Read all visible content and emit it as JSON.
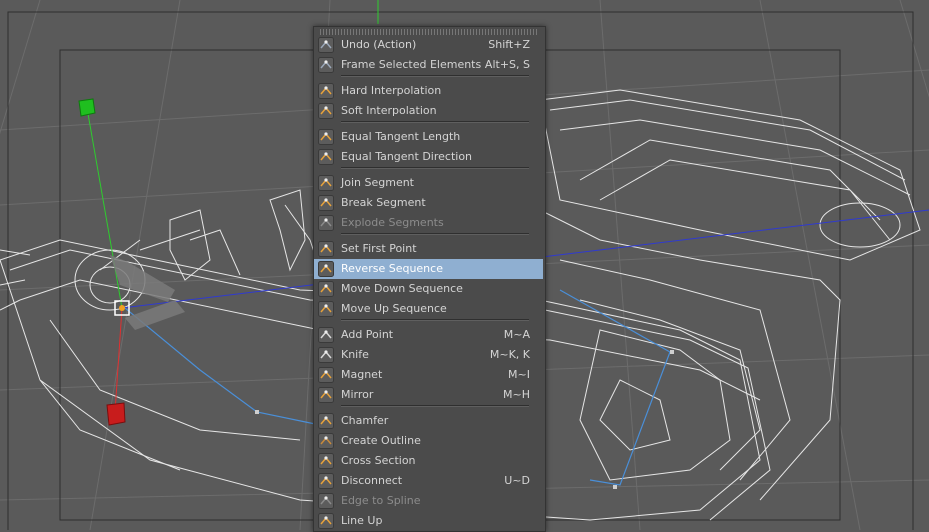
{
  "menu": {
    "items": [
      {
        "label": "Undo (Action)",
        "shortcut": "Shift+Z",
        "icon": "undo-icon"
      },
      {
        "label": "Frame Selected Elements",
        "shortcut": "Alt+S, S",
        "icon": "frame-selected-icon"
      },
      {
        "label": "Hard Interpolation",
        "shortcut": "",
        "icon": "hard-interpolation-icon"
      },
      {
        "label": "Soft Interpolation",
        "shortcut": "",
        "icon": "soft-interpolation-icon"
      },
      {
        "label": "Equal Tangent Length",
        "shortcut": "",
        "icon": "equal-tangent-length-icon"
      },
      {
        "label": "Equal Tangent Direction",
        "shortcut": "",
        "icon": "equal-tangent-direction-icon"
      },
      {
        "label": "Join Segment",
        "shortcut": "",
        "icon": "join-segment-icon"
      },
      {
        "label": "Break Segment",
        "shortcut": "",
        "icon": "break-segment-icon"
      },
      {
        "label": "Explode Segments",
        "shortcut": "",
        "icon": "explode-segments-icon",
        "disabled": true
      },
      {
        "label": "Set First Point",
        "shortcut": "",
        "icon": "set-first-point-icon"
      },
      {
        "label": "Reverse Sequence",
        "shortcut": "",
        "icon": "reverse-sequence-icon",
        "highlighted": true
      },
      {
        "label": "Move Down Sequence",
        "shortcut": "",
        "icon": "move-down-sequence-icon"
      },
      {
        "label": "Move Up Sequence",
        "shortcut": "",
        "icon": "move-up-sequence-icon"
      },
      {
        "label": "Add Point",
        "shortcut": "M~A",
        "icon": "add-point-icon"
      },
      {
        "label": "Knife",
        "shortcut": "M~K, K",
        "icon": "knife-icon"
      },
      {
        "label": "Magnet",
        "shortcut": "M~I",
        "icon": "magnet-icon"
      },
      {
        "label": "Mirror",
        "shortcut": "M~H",
        "icon": "mirror-icon"
      },
      {
        "label": "Chamfer",
        "shortcut": "",
        "icon": "chamfer-icon"
      },
      {
        "label": "Create Outline",
        "shortcut": "",
        "icon": "create-outline-icon"
      },
      {
        "label": "Cross Section",
        "shortcut": "",
        "icon": "cross-section-icon"
      },
      {
        "label": "Disconnect",
        "shortcut": "U~D",
        "icon": "disconnect-icon"
      },
      {
        "label": "Edge to Spline",
        "shortcut": "",
        "icon": "edge-to-spline-icon",
        "disabled": true
      },
      {
        "label": "Line Up",
        "shortcut": "",
        "icon": "line-up-icon"
      }
    ]
  },
  "colors": {
    "viewport_bg": "#5a5a5a",
    "grid": "#6a6a6a",
    "wire": "#e8e8e8",
    "spline": "#4a90d9",
    "axis_x": "#d02020",
    "axis_y": "#22c822",
    "axis_z": "#2a3ad0",
    "menu_bg": "#4b4b4b",
    "highlight": "#8fafd1",
    "icon_accent": "#e8a23a"
  }
}
